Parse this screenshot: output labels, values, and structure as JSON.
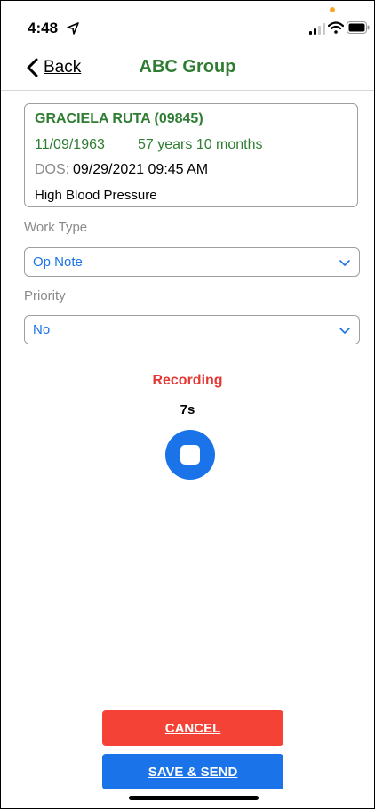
{
  "status_bar": {
    "time": "4:48"
  },
  "nav": {
    "back_label": "Back",
    "title": "ABC Group"
  },
  "patient": {
    "name": "GRACIELA RUTA (09845)",
    "dob": "11/09/1963",
    "age": "57 years 10 months",
    "dos_label": "DOS:",
    "dos_value": "09/29/2021 09:45  AM",
    "diagnosis": "High Blood Pressure"
  },
  "work_type": {
    "label": "Work Type",
    "value": "Op Note"
  },
  "priority": {
    "label": "Priority",
    "value": "No"
  },
  "recording": {
    "status": "Recording",
    "elapsed": "7s"
  },
  "actions": {
    "cancel_label": "CANCEL",
    "save_label": "SAVE & SEND"
  },
  "colors": {
    "brand_green": "#2e7d32",
    "accent_blue": "#1a73e8",
    "danger_red": "#f44336",
    "recording_red": "#e53935"
  },
  "icons": [
    "location-arrow-icon",
    "signal-icon",
    "wifi-icon",
    "battery-icon",
    "chevron-left-icon",
    "chevron-down-icon",
    "stop-icon"
  ]
}
